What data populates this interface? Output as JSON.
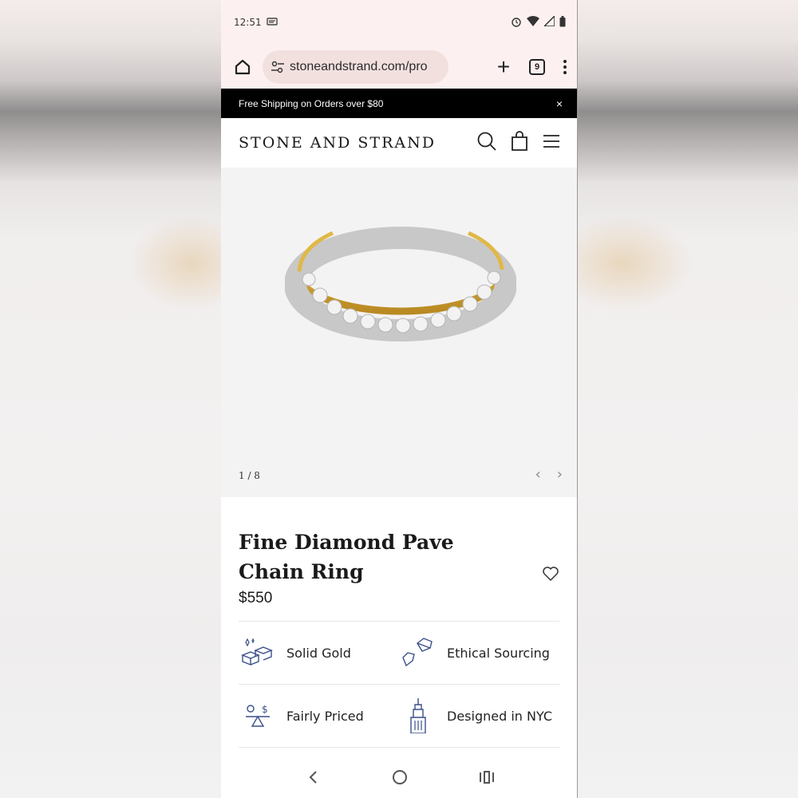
{
  "statusbar": {
    "time": "12:51"
  },
  "browser": {
    "url": "stoneandstrand.com/pro",
    "tab_count": "9"
  },
  "promo": {
    "text": "Free Shipping on Orders over $80",
    "close": "×"
  },
  "site": {
    "logo": "STONE AND STRAND"
  },
  "gallery": {
    "counter": "1 / 8",
    "prev": "‹",
    "next": "›"
  },
  "product": {
    "title": "Fine Diamond Pave Chain Ring",
    "price": "$550"
  },
  "features": [
    {
      "label": "Solid Gold",
      "icon": "gold-bars-icon"
    },
    {
      "label": "Ethical Sourcing",
      "icon": "diamonds-icon"
    },
    {
      "label": "Fairly Priced",
      "icon": "scale-icon"
    },
    {
      "label": "Designed in NYC",
      "icon": "building-icon"
    }
  ],
  "colors": {
    "promo_bg": "#000000",
    "browser_bar": "#fcf1f0",
    "url_pill": "#f2e0df",
    "icon_blue": "#3a4f8a"
  }
}
